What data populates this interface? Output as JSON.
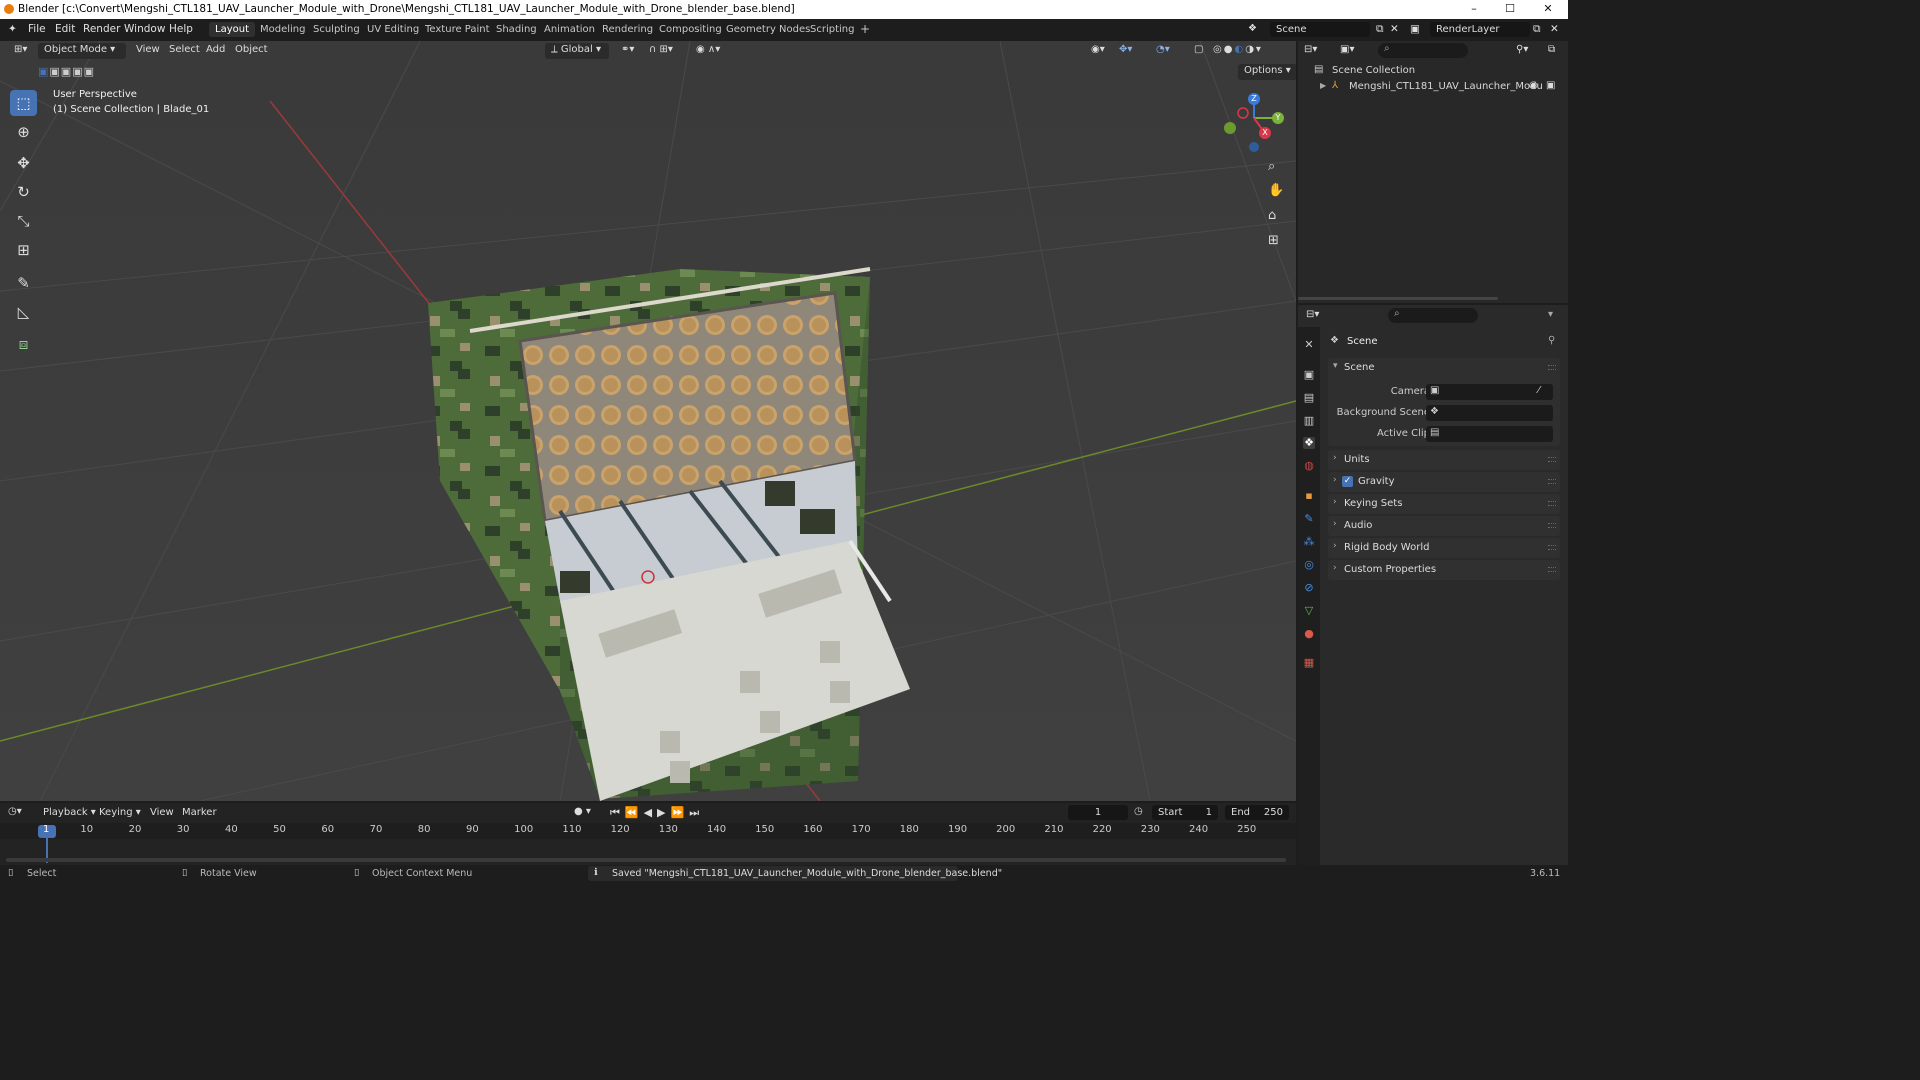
{
  "window": {
    "title": "Blender [c:\\Convert\\Mengshi_CTL181_UAV_Launcher_Module_with_Drone\\Mengshi_CTL181_UAV_Launcher_Module_with_Drone_blender_base.blend]",
    "minimize": "–",
    "maximize": "☐",
    "close": "✕"
  },
  "menu": [
    "File",
    "Edit",
    "Render",
    "Window",
    "Help"
  ],
  "workspaces": [
    "Layout",
    "Modeling",
    "Sculpting",
    "UV Editing",
    "Texture Paint",
    "Shading",
    "Animation",
    "Rendering",
    "Compositing",
    "Geometry Nodes",
    "Scripting",
    "+"
  ],
  "scene_selector": "Scene",
  "renderlayer_selector": "RenderLayer",
  "viewport": {
    "mode": "Object Mode",
    "menus": [
      "View",
      "Select",
      "Add",
      "Object"
    ],
    "orientation": "Global",
    "options": "Options",
    "overlay_line1": "User Perspective",
    "overlay_line2": "(1) Scene Collection | Blade_01",
    "gizmo": {
      "z": "Z",
      "y": "Y",
      "x": "X"
    }
  },
  "outliner": {
    "root": "Scene Collection",
    "item": "Mengshi_CTL181_UAV_Launcher_Modu"
  },
  "properties": {
    "header": "Scene",
    "panel": "Scene",
    "camera_label": "Camera",
    "background_label": "Background Scene",
    "clip_label": "Active Clip",
    "sections": [
      "Units",
      "Gravity",
      "Keying Sets",
      "Audio",
      "Rigid Body World",
      "Custom Properties"
    ]
  },
  "timeline": {
    "menus": [
      "Playback",
      "Keying",
      "View",
      "Marker"
    ],
    "current_frame": "1",
    "start_label": "Start",
    "start": "1",
    "end_label": "End",
    "end": "250",
    "ticks": [
      "1",
      "10",
      "20",
      "30",
      "40",
      "50",
      "60",
      "70",
      "80",
      "90",
      "100",
      "110",
      "120",
      "130",
      "140",
      "150",
      "160",
      "170",
      "180",
      "190",
      "200",
      "210",
      "220",
      "230",
      "240",
      "250"
    ]
  },
  "status": {
    "select": "Select",
    "rotate": "Rotate View",
    "context": "Object Context Menu",
    "message": "Saved \"Mengshi_CTL181_UAV_Launcher_Module_with_Drone_blender_base.blend\"",
    "version": "3.6.11"
  }
}
